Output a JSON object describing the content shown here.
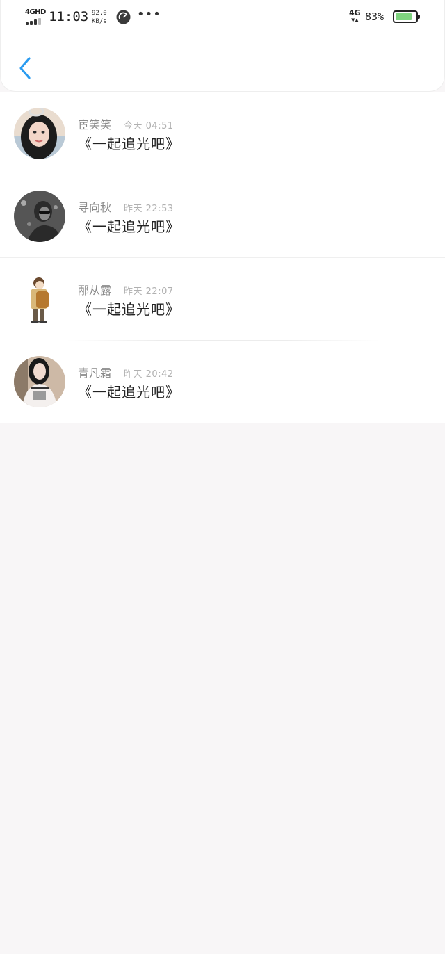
{
  "status_bar": {
    "network_type": "4GHD",
    "time": "11:03",
    "speed_value": "92.0",
    "speed_unit": "KB/s",
    "more": "•••",
    "cell_type": "4G",
    "battery_percent": "83%",
    "battery_level": 0.83,
    "battery_color": "#7fd37f"
  },
  "header": {
    "back_icon": "chevron-left-icon",
    "accent_color": "#2a9bf0"
  },
  "list": [
    {
      "name": "宦笑笑",
      "time": "今天 04:51",
      "message": "《一起追光吧》",
      "avatar": "woman-selfie-avatar"
    },
    {
      "name": "寻向秋",
      "time": "昨天 22:53",
      "message": "《一起追光吧》",
      "avatar": "bw-portrait-avatar"
    },
    {
      "name": "邴从露",
      "time": "昨天 22:07",
      "message": "《一起追光吧》",
      "avatar": "cartoon-backpack-avatar"
    },
    {
      "name": "青凡霜",
      "time": "昨天 20:42",
      "message": "《一起追光吧》",
      "avatar": "girl-tshirt-avatar"
    }
  ]
}
